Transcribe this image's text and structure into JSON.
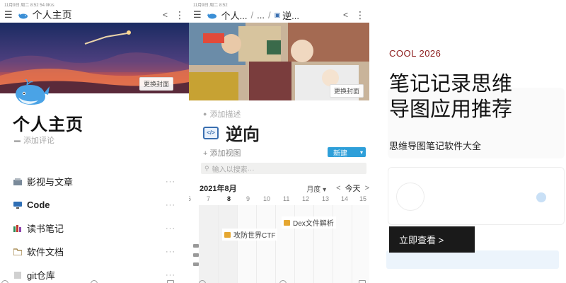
{
  "phone1": {
    "status_text": "11月9日 周二 8:52   54.0K/s",
    "nav": {
      "title": "个人主页"
    },
    "cover_button": "更换封面",
    "page_title": "个人主页",
    "comment_placeholder": "添加评论",
    "items": [
      {
        "label": "影视与文章",
        "icon": "film-icon"
      },
      {
        "label": "Code",
        "icon": "monitor-icon"
      },
      {
        "label": "读书笔记",
        "icon": "books-icon"
      },
      {
        "label": "软件文档",
        "icon": "folder-icon"
      },
      {
        "label": "git仓库",
        "icon": "repo-icon"
      }
    ],
    "more_glyph": "···"
  },
  "phone2": {
    "status_text": "11月9日 周二 8:52",
    "breadcrumb": [
      "个人...",
      "...",
      "逆..."
    ],
    "cover_button": "更换封面",
    "description_placeholder": "添加描述",
    "page_title": "逆向",
    "page_icon_text": "</>",
    "add_view": "+ 添加视图",
    "new_button": "新建",
    "search_placeholder": "输入以搜索···",
    "calendar": {
      "month": "2021年8月",
      "mode": "月度",
      "today": "今天",
      "days": [
        "6",
        "7",
        "8",
        "9",
        "10",
        "11",
        "12",
        "13",
        "14",
        "15"
      ],
      "events": [
        {
          "label": "Dex文件解析"
        },
        {
          "label": "攻防世界CTF"
        }
      ]
    }
  },
  "ad": {
    "tag": "COOL 2026",
    "headline": "笔记记录思维导图应用推荐",
    "headline_line1": "笔记记录思维",
    "headline_line2": "导图应用推荐",
    "subline": "思维导图笔记软件大全",
    "cta": "立即查看 >"
  },
  "colors": {
    "accent_blue": "#2e9fd9",
    "tag_red": "#8b1a1a",
    "cta_bg": "#1a1a1a"
  }
}
